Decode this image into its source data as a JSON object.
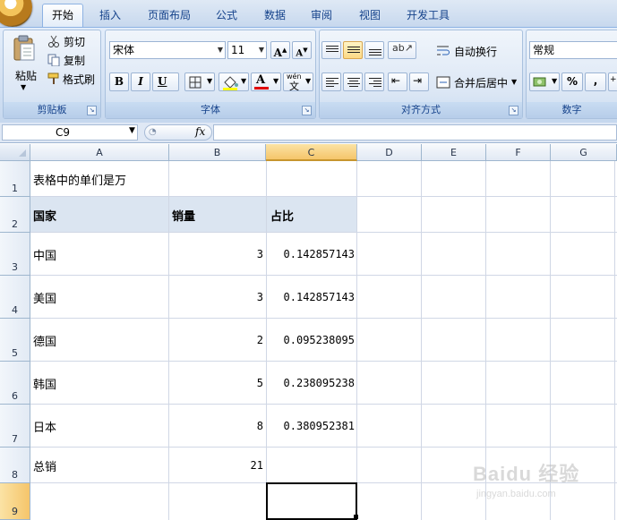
{
  "ribbon": {
    "tabs": [
      {
        "label": "开始",
        "active": true
      },
      {
        "label": "插入"
      },
      {
        "label": "页面布局"
      },
      {
        "label": "公式"
      },
      {
        "label": "数据"
      },
      {
        "label": "审阅"
      },
      {
        "label": "视图"
      },
      {
        "label": "开发工具"
      }
    ],
    "clipboard": {
      "paste": "粘贴",
      "cut": "剪切",
      "copy": "复制",
      "format_painter": "格式刷",
      "group_label": "剪贴板"
    },
    "font": {
      "font_name": "宋体",
      "font_size": "11",
      "bold": "B",
      "italic": "I",
      "underline": "U",
      "group_label": "字体"
    },
    "alignment": {
      "wrap_text": "自动换行",
      "merge_center": "合并后居中",
      "group_label": "对齐方式"
    },
    "number": {
      "format": "常规",
      "percent": "%",
      "comma": ",",
      "group_label": "数字"
    }
  },
  "formula_bar": {
    "name_box": "C9",
    "fx": "fx",
    "formula": ""
  },
  "grid": {
    "columns": [
      "A",
      "B",
      "C",
      "D",
      "E",
      "F",
      "G"
    ],
    "selected_column": "C",
    "rows": [
      "1",
      "2",
      "3",
      "4",
      "5",
      "6",
      "7",
      "8",
      "9"
    ],
    "selected_row": "9",
    "cells": {
      "A1": "表格中的单们是万",
      "A2": "国家",
      "B2": "销量",
      "C2": "占比",
      "A3": "中国",
      "B3": "3",
      "C3": "0.142857143",
      "A4": "美国",
      "B4": "3",
      "C4": "0.142857143",
      "A5": "德国",
      "B5": "2",
      "C5": "0.095238095",
      "A6": "韩国",
      "B6": "5",
      "C6": "0.238095238",
      "A7": "日本",
      "B7": "8",
      "C7": "0.380952381",
      "A8": "总销",
      "B8": "21"
    },
    "header_fill_color": "#dbe5f1",
    "selection_color": "#f5c56a"
  },
  "watermark": {
    "logo": "Baidu 经验",
    "url": "jingyan.baidu.com"
  }
}
